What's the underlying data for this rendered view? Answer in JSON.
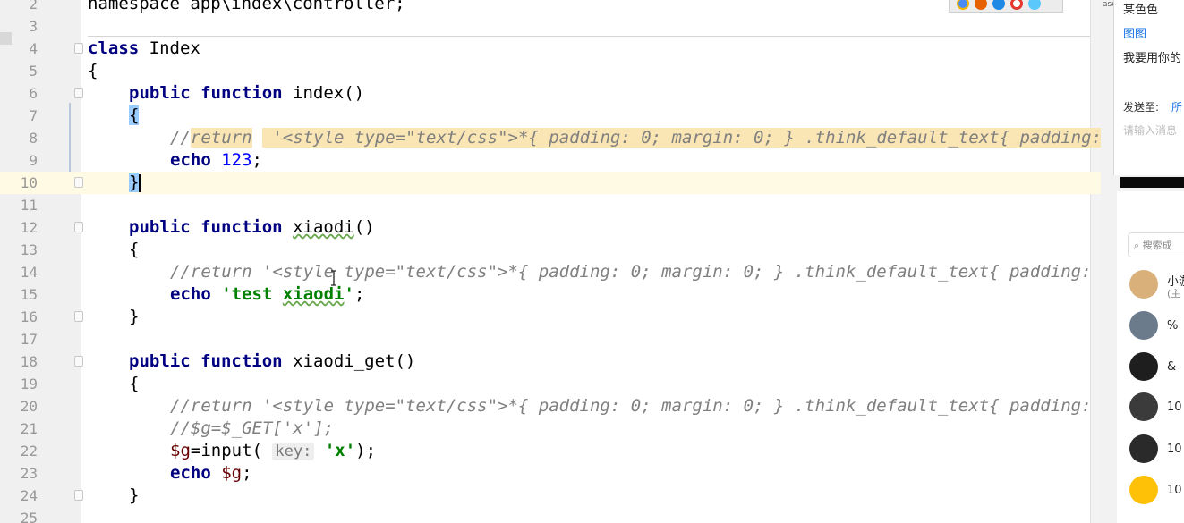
{
  "editor": {
    "lines": [
      {
        "n": "2"
      },
      {
        "n": "3"
      },
      {
        "n": "4"
      },
      {
        "n": "5"
      },
      {
        "n": "6"
      },
      {
        "n": "7"
      },
      {
        "n": "8"
      },
      {
        "n": "9"
      },
      {
        "n": "10"
      },
      {
        "n": "11"
      },
      {
        "n": "12"
      },
      {
        "n": "13"
      },
      {
        "n": "14"
      },
      {
        "n": "15"
      },
      {
        "n": "16"
      },
      {
        "n": "17"
      },
      {
        "n": "18"
      },
      {
        "n": "19"
      },
      {
        "n": "20"
      },
      {
        "n": "21"
      },
      {
        "n": "22"
      },
      {
        "n": "23"
      },
      {
        "n": "24"
      },
      {
        "n": "25"
      }
    ],
    "code": {
      "namespace": "namespace app\\index\\controller;",
      "kw_class": "class",
      "class_name": " Index",
      "brace_open": "{",
      "brace_close": "}",
      "kw_public": "public",
      "kw_function": "function",
      "fn_index": " index()",
      "comment_return_prefix": "//",
      "comment_return_word": "return",
      "comment_return_rest": " '<style type=\"text/css\">*{ padding: 0; margin: 0; } .think_default_text{ padding:",
      "comment_return_full": "//return '<style type=\"text/css\">*{ padding: 0; margin: 0; } .think_default_text{ padding:",
      "kw_echo": "echo",
      "num_123": "123",
      "semicolon": ";",
      "fn_xiaodi_name": "xiaodi",
      "fn_parens": "()",
      "str_test_part1": "'test ",
      "str_test_part2": "xiaodi",
      "str_test_part3": "'",
      "fn_xiaodi_get_name": "xiaodi_get",
      "comment_get": "//$g=$_GET['x'];",
      "var_g": "$g",
      "input_call": "=input(",
      "param_hint": "key:",
      "str_x": "'x'",
      "close_call": ");"
    }
  },
  "browser_icons": [
    {
      "name": "chrome-icon",
      "color": "#4c8bf5"
    },
    {
      "name": "firefox-icon",
      "color": "#e66000"
    },
    {
      "name": "ie-icon",
      "color": "#1e88e5"
    },
    {
      "name": "opera-icon",
      "color": "#e23a2e"
    },
    {
      "name": "safari-icon",
      "color": "#5ac8fa"
    }
  ],
  "chat": {
    "side_label": "ase",
    "color_text": "某色色",
    "image_link": "图图",
    "message_text": "我要用你的",
    "send_to_label": "发送至:",
    "send_to_value": "所",
    "input_placeholder": "请输入消息",
    "search_placeholder": "搜索成",
    "contacts": [
      {
        "name": "小游",
        "sub": "(主",
        "avatar_color": "#d9b07a"
      },
      {
        "name": "%",
        "sub": "",
        "avatar_color": "#6b7b8c"
      },
      {
        "name": "&",
        "sub": "",
        "avatar_color": "#1e1e1e"
      },
      {
        "name": "10",
        "sub": "",
        "avatar_color": "#3b3b3b"
      },
      {
        "name": "10",
        "sub": "",
        "avatar_color": "#2a2a2a"
      },
      {
        "name": "10",
        "sub": "",
        "avatar_color": "#ffc107"
      }
    ]
  }
}
